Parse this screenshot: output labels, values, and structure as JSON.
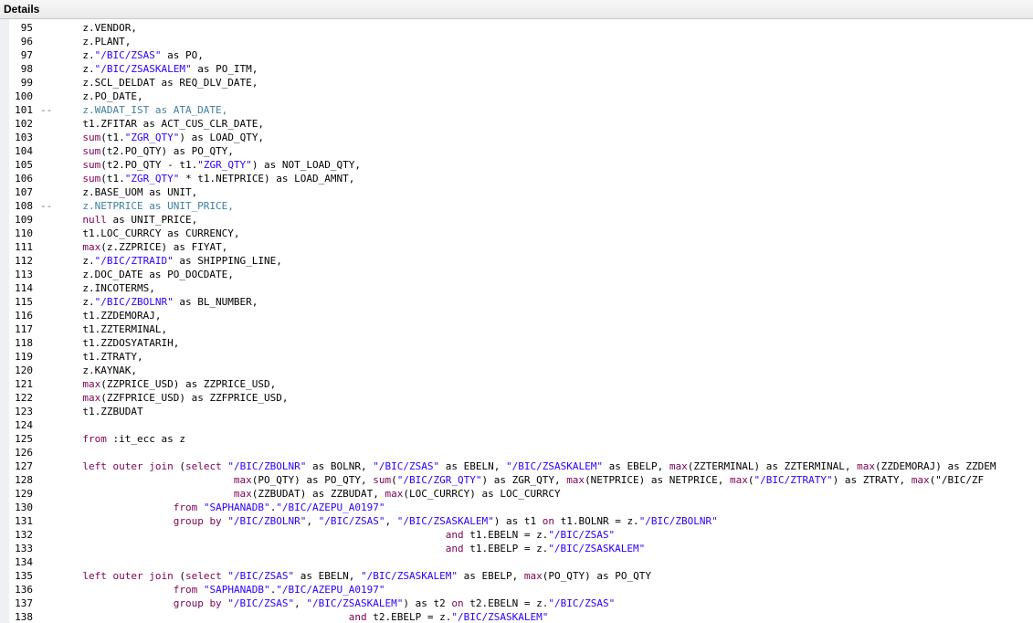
{
  "panel": {
    "title": "Details"
  },
  "lines": [
    {
      "n": "95",
      "t": "       z.VENDOR,"
    },
    {
      "n": "96",
      "t": "       z.PLANT,"
    },
    {
      "n": "97",
      "t": "       z.\"/BIC/ZSAS\" as PO,"
    },
    {
      "n": "98",
      "t": "       z.\"/BIC/ZSASKALEM\" as PO_ITM,"
    },
    {
      "n": "99",
      "t": "       z.SCL_DELDAT as REQ_DLV_DATE,"
    },
    {
      "n": "100",
      "t": "       z.PO_DATE,"
    },
    {
      "n": "101",
      "t": "--     z.WADAT_IST as ATA_DATE,"
    },
    {
      "n": "102",
      "t": "       t1.ZFITAR as ACT_CUS_CLR_DATE,"
    },
    {
      "n": "103",
      "t": "       sum(t1.\"ZGR_QTY\") as LOAD_QTY,"
    },
    {
      "n": "104",
      "t": "       sum(t2.PO_QTY) as PO_QTY,"
    },
    {
      "n": "105",
      "t": "       sum(t2.PO_QTY - t1.\"ZGR_QTY\") as NOT_LOAD_QTY,"
    },
    {
      "n": "106",
      "t": "       sum(t1.\"ZGR_QTY\" * t1.NETPRICE) as LOAD_AMNT,"
    },
    {
      "n": "107",
      "t": "       z.BASE_UOM as UNIT,"
    },
    {
      "n": "108",
      "t": "--     z.NETPRICE as UNIT_PRICE,"
    },
    {
      "n": "109",
      "t": "       null as UNIT_PRICE,"
    },
    {
      "n": "110",
      "t": "       t1.LOC_CURRCY as CURRENCY,"
    },
    {
      "n": "111",
      "t": "       max(z.ZZPRICE) as FIYAT,"
    },
    {
      "n": "112",
      "t": "       z.\"/BIC/ZTRAID\" as SHIPPING_LINE,"
    },
    {
      "n": "113",
      "t": "       z.DOC_DATE as PO_DOCDATE,"
    },
    {
      "n": "114",
      "t": "       z.INCOTERMS,"
    },
    {
      "n": "115",
      "t": "       z.\"/BIC/ZBOLNR\" as BL_NUMBER,"
    },
    {
      "n": "116",
      "t": "       t1.ZZDEMORAJ,"
    },
    {
      "n": "117",
      "t": "       t1.ZZTERMINAL,"
    },
    {
      "n": "118",
      "t": "       t1.ZZDOSYATARIH,"
    },
    {
      "n": "119",
      "t": "       t1.ZTRATY,"
    },
    {
      "n": "120",
      "t": "       z.KAYNAK,"
    },
    {
      "n": "121",
      "t": "       max(ZZPRICE_USD) as ZZPRICE_USD,"
    },
    {
      "n": "122",
      "t": "       max(ZZFPRICE_USD) as ZZFPRICE_USD,"
    },
    {
      "n": "123",
      "t": "       t1.ZZBUDAT"
    },
    {
      "n": "124",
      "t": ""
    },
    {
      "n": "125",
      "t": "       from :it_ecc as z"
    },
    {
      "n": "126",
      "t": ""
    },
    {
      "n": "127",
      "t": "       left outer join (select \"/BIC/ZBOLNR\" as BOLNR, \"/BIC/ZSAS\" as EBELN, \"/BIC/ZSASKALEM\" as EBELP, max(ZZTERMINAL) as ZZTERMINAL, max(ZZDEMORAJ) as ZZDEM"
    },
    {
      "n": "128",
      "t": "                                max(PO_QTY) as PO_QTY, sum(\"/BIC/ZGR_QTY\") as ZGR_QTY, max(NETPRICE) as NETPRICE, max(\"/BIC/ZTRATY\") as ZTRATY, max(\"/BIC/ZF"
    },
    {
      "n": "129",
      "t": "                                max(ZZBUDAT) as ZZBUDAT, max(LOC_CURRCY) as LOC_CURRCY"
    },
    {
      "n": "130",
      "t": "                      from \"SAPHANADB\".\"/BIC/AZEPU_A0197\""
    },
    {
      "n": "131",
      "t": "                      group by \"/BIC/ZBOLNR\", \"/BIC/ZSAS\", \"/BIC/ZSASKALEM\") as t1 on t1.BOLNR = z.\"/BIC/ZBOLNR\""
    },
    {
      "n": "132",
      "t": "                                                                   and t1.EBELN = z.\"/BIC/ZSAS\""
    },
    {
      "n": "133",
      "t": "                                                                   and t1.EBELP = z.\"/BIC/ZSASKALEM\""
    },
    {
      "n": "134",
      "t": ""
    },
    {
      "n": "135",
      "t": "       left outer join (select \"/BIC/ZSAS\" as EBELN, \"/BIC/ZSASKALEM\" as EBELP, max(PO_QTY) as PO_QTY"
    },
    {
      "n": "136",
      "t": "                      from \"SAPHANADB\".\"/BIC/AZEPU_A0197\""
    },
    {
      "n": "137",
      "t": "                      group by \"/BIC/ZSAS\", \"/BIC/ZSASKALEM\") as t2 on t2.EBELN = z.\"/BIC/ZSAS\""
    },
    {
      "n": "138",
      "t": "                                                   and t2.EBELP = z.\"/BIC/ZSASKALEM\""
    }
  ]
}
